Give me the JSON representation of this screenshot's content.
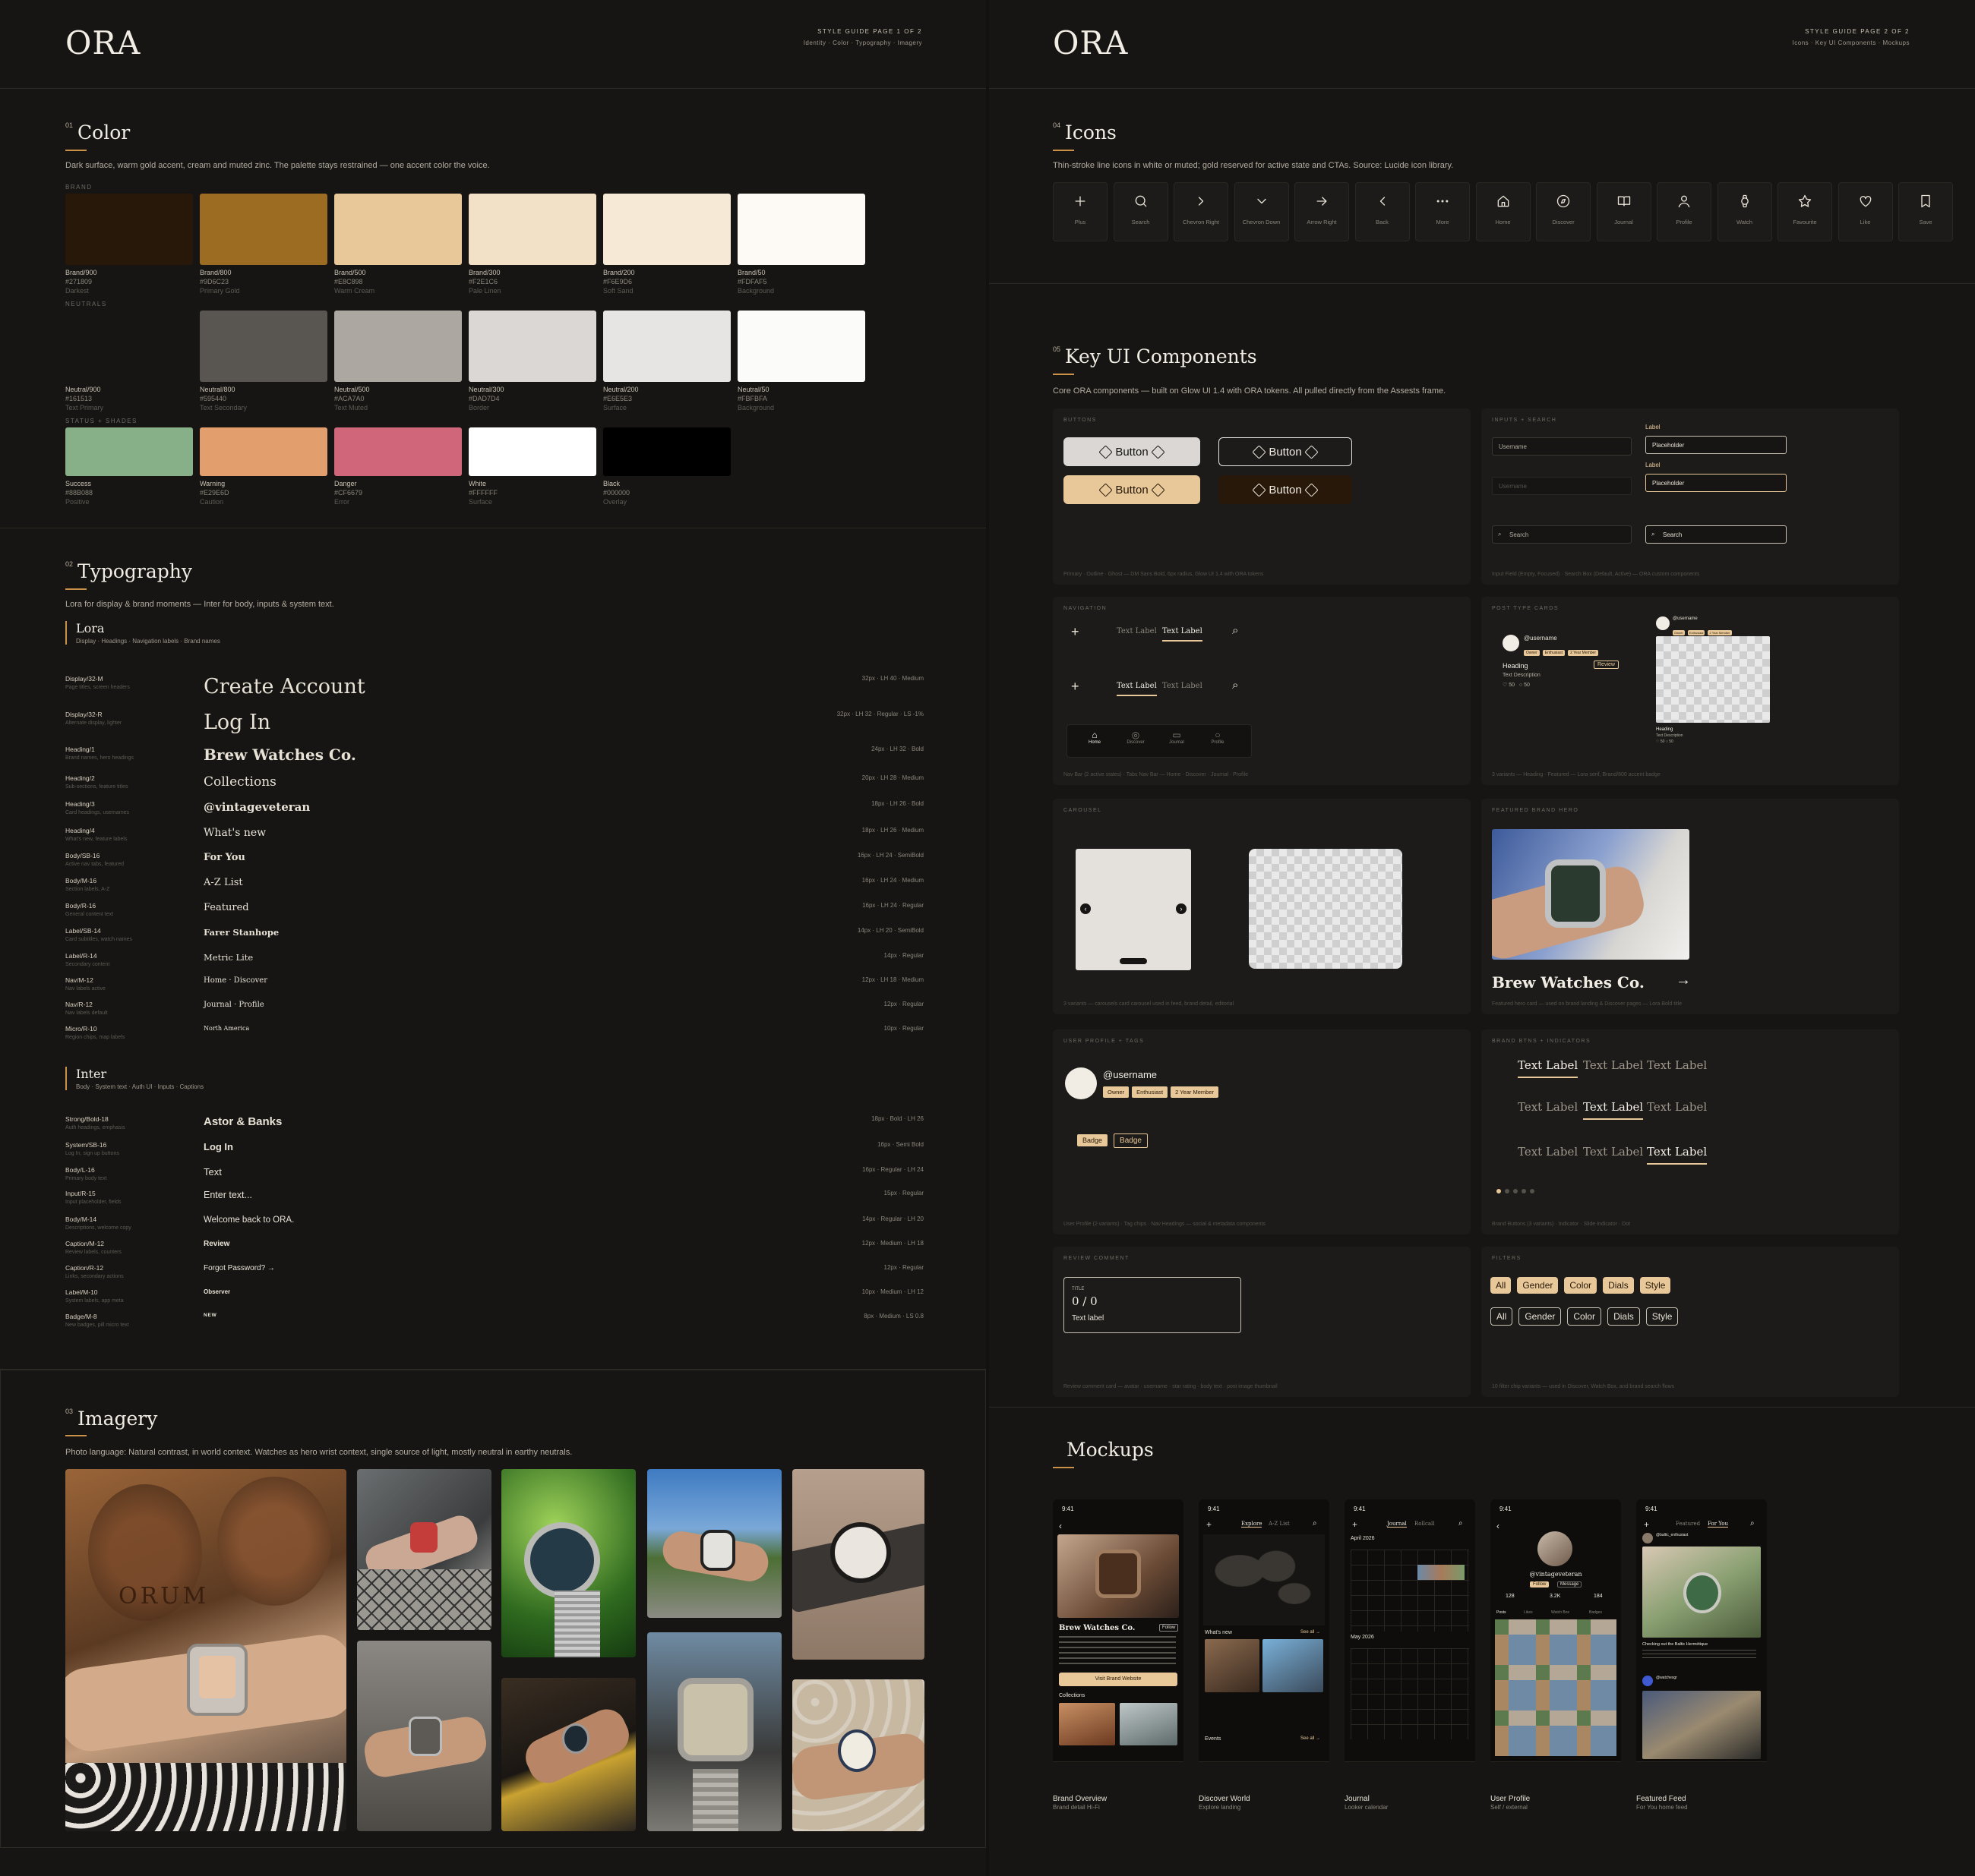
{
  "page1": {
    "logo": "ORA",
    "header_title": "STYLE GUIDE PAGE 1 OF 2",
    "header_sub": "Identity · Color · Typography · Imagery"
  },
  "page2": {
    "logo": "ORA",
    "header_title": "STYLE GUIDE PAGE 2 OF 2",
    "header_sub": "Icons · Key UI Components · Mockups"
  },
  "color": {
    "num": "01",
    "title": "Color",
    "desc": "Dark surface, warm gold accent, cream and muted zinc. The palette stays restrained — one accent color the voice.",
    "brand_label": "BRAND",
    "neutrals_label": "NEUTRALS",
    "status_label": "STATUS + SHADES",
    "brand": [
      {
        "name": "Brand/900",
        "hex": "#271809",
        "desc": "Darkest",
        "color": "#271809"
      },
      {
        "name": "Brand/800",
        "hex": "#9D6C23",
        "desc": "Primary Gold",
        "color": "#9D6C23"
      },
      {
        "name": "Brand/500",
        "hex": "#E8C898",
        "desc": "Warm Cream",
        "color": "#E8C898"
      },
      {
        "name": "Brand/300",
        "hex": "#F2E1C6",
        "desc": "Pale Linen",
        "color": "#F2E1C6"
      },
      {
        "name": "Brand/200",
        "hex": "#F6E9D6",
        "desc": "Soft Sand",
        "color": "#F6E9D6"
      },
      {
        "name": "Brand/50",
        "hex": "#FDFAF5",
        "desc": "Background",
        "color": "#FDFAF5"
      }
    ],
    "neutrals": [
      {
        "name": "Neutral/900",
        "hex": "#161513",
        "desc": "Text Primary",
        "color": "#161513"
      },
      {
        "name": "Neutral/800",
        "hex": "#595440",
        "desc": "Text Secondary",
        "color": "#595550"
      },
      {
        "name": "Neutral/500",
        "hex": "#ACA7A0",
        "desc": "Text Muted",
        "color": "#ACA7A0"
      },
      {
        "name": "Neutral/300",
        "hex": "#DAD7D4",
        "desc": "Border",
        "color": "#DAD7D4"
      },
      {
        "name": "Neutral/200",
        "hex": "#E6E5E3",
        "desc": "Surface",
        "color": "#E6E5E3"
      },
      {
        "name": "Neutral/50",
        "hex": "#FBFBFA",
        "desc": "Background",
        "color": "#FBFBFA"
      }
    ],
    "status": [
      {
        "name": "Success",
        "hex": "#88B088",
        "desc": "Positive",
        "color": "#88B088"
      },
      {
        "name": "Warning",
        "hex": "#E29E6D",
        "desc": "Caution",
        "color": "#E29E6D"
      },
      {
        "name": "Danger",
        "hex": "#CF6679",
        "desc": "Error",
        "color": "#CF6679"
      },
      {
        "name": "White",
        "hex": "#FFFFFF",
        "desc": "Surface",
        "color": "#FFFFFF"
      },
      {
        "name": "Black",
        "hex": "#000000",
        "desc": "Overlay",
        "color": "#000000"
      }
    ]
  },
  "typography": {
    "num": "02",
    "title": "Typography",
    "desc": "Lora for display & brand moments — Inter for body, inputs & system text.",
    "lora": {
      "name": "Lora",
      "usage": "Display · Headings · Navigation labels · Brand names"
    },
    "inter": {
      "name": "Inter",
      "usage": "Body · System text · Auth UI · Inputs · Captions"
    },
    "lora_rows": [
      {
        "name": "Display/32-M",
        "sub": "Page titles, screen headers",
        "sample": "Create Account",
        "spec": "32px · LH 40 · Medium"
      },
      {
        "name": "Display/32-R",
        "sub": "Alternate display, lighter",
        "sample": "Log In",
        "spec": "32px · LH 32 · Regular · LS -1%"
      },
      {
        "name": "Heading/1",
        "sub": "Brand names, hero headings",
        "sample": "Brew Watches Co.",
        "spec": "24px · LH 32 · Bold"
      },
      {
        "name": "Heading/2",
        "sub": "Sub-sections, feature titles",
        "sample": "Collections",
        "spec": "20px · LH 28 · Medium"
      },
      {
        "name": "Heading/3",
        "sub": "Card headings, usernames",
        "sample": "@vintageveteran",
        "spec": "18px · LH 26 · Bold"
      },
      {
        "name": "Heading/4",
        "sub": "What's new, feature labels",
        "sample": "What's new",
        "spec": "18px · LH 26 · Medium"
      },
      {
        "name": "Body/SB-16",
        "sub": "Active nav tabs, featured",
        "sample": "For You",
        "spec": "16px · LH 24 · SemiBold"
      },
      {
        "name": "Body/M-16",
        "sub": "Section labels, A-Z",
        "sample": "A-Z List",
        "spec": "16px · LH 24 · Medium"
      },
      {
        "name": "Body/R-16",
        "sub": "General content text",
        "sample": "Featured",
        "spec": "16px · LH 24 · Regular"
      },
      {
        "name": "Label/SB-14",
        "sub": "Card subtitles, watch names",
        "sample": "Farer Stanhope",
        "spec": "14px · LH 20 · SemiBold"
      },
      {
        "name": "Label/R-14",
        "sub": "Secondary content",
        "sample": "Metric Lite",
        "spec": "14px · Regular"
      },
      {
        "name": "Nav/M-12",
        "sub": "Nav labels active",
        "sample": "Home · Discover",
        "spec": "12px · LH 18 · Medium"
      },
      {
        "name": "Nav/R-12",
        "sub": "Nav labels default",
        "sample": "Journal · Profile",
        "spec": "12px · Regular"
      },
      {
        "name": "Micro/R-10",
        "sub": "Region chips, map labels",
        "sample": "North America",
        "spec": "10px · Regular"
      }
    ],
    "inter_rows": [
      {
        "name": "Strong/Bold-18",
        "sub": "Auth headings, emphasis",
        "sample": "Astor & Banks",
        "spec": "18px · Bold · LH 26"
      },
      {
        "name": "System/SB-16",
        "sub": "Log In, sign up buttons",
        "sample": "Log In",
        "spec": "16px · Semi Bold"
      },
      {
        "name": "Body/L-16",
        "sub": "Primary body text",
        "sample": "Text",
        "spec": "16px · Regular · LH 24"
      },
      {
        "name": "Input/R-15",
        "sub": "Input placeholder, fields",
        "sample": "Enter text...",
        "spec": "15px · Regular"
      },
      {
        "name": "Body/M-14",
        "sub": "Descriptions, welcome copy",
        "sample": "Welcome back to ORA.",
        "spec": "14px · Regular · LH 20"
      },
      {
        "name": "Caption/M-12",
        "sub": "Review labels, counters",
        "sample": "Review",
        "spec": "12px · Medium · LH 18"
      },
      {
        "name": "Caption/R-12",
        "sub": "Links, secondary actions",
        "sample": "Forgot Password? →",
        "spec": "12px · Regular"
      },
      {
        "name": "Label/M-10",
        "sub": "System labels, app meta",
        "sample": "Observer",
        "spec": "10px · Medium · LH 12"
      },
      {
        "name": "Badge/M-8",
        "sub": "New badges, pill micro text",
        "sample": "NEW",
        "spec": "8px · Medium · LS 0.8"
      }
    ]
  },
  "imagery": {
    "num": "03",
    "title": "Imagery",
    "desc": "Photo language: Natural contrast, in world context. Watches as hero wrist context, single source of light, mostly neutral in earthy neutrals.",
    "photo_text": "ORUM"
  },
  "icons": {
    "num": "04",
    "title": "Icons",
    "desc": "Thin-stroke line icons in white or muted; gold reserved for active state and CTAs. Source: Lucide icon library.",
    "items": [
      "Plus",
      "Search",
      "Chevron Right",
      "Chevron Down",
      "Arrow Right",
      "Back",
      "More",
      "Home",
      "Discover",
      "Journal",
      "Profile",
      "Watch",
      "Favourite",
      "Like",
      "Save"
    ]
  },
  "components": {
    "num": "05",
    "title": "Key UI Components",
    "desc": "Core ORA components — built on Glow UI 1.4 with ORA tokens. All pulled directly from the Assests frame.",
    "buttons": {
      "label": "BUTTONS",
      "text": "Button",
      "footer": "Primary · Outline · Ghost — DM Sans Bold, 6px radius, Glow UI 1.4 with ORA tokens"
    },
    "inputs": {
      "label": "INPUTS + SEARCH",
      "username": "Username",
      "field_label": "Label",
      "placeholder": "Placeholder",
      "search": "Search",
      "footer": "Input Field (Empty, Focused) · Search Box (Default, Active) — ORA custom components"
    },
    "navigation": {
      "label": "NAVIGATION",
      "tab": "Text Label",
      "nav": [
        "Home",
        "Discover",
        "Journal",
        "Profile"
      ],
      "footer": "Nav Bar (2 active states) · Tabs Nav Bar — Home · Discover · Journal · Profile"
    },
    "posts": {
      "label": "POST TYPE CARDS",
      "username": "@username",
      "chips": [
        "Owner",
        "Enthusiast",
        "2 Year Member"
      ],
      "heading": "Heading",
      "review": "Review",
      "text_desc": "Text Description",
      "count1": "50",
      "count2": "50",
      "small_count": "50",
      "footer": "3 variants — Heading · Featured — Lora serif, Brand/800 accent badge"
    },
    "carousel": {
      "label": "CAROUSEL",
      "footer": "3 variants — carousels card carousel used in feed, brand detail, editorial"
    },
    "hero": {
      "label": "FEATURED BRAND HERO",
      "title": "Brew Watches Co.",
      "footer": "Featured hero card — used on brand landing & Discover pages — Lora Bold title"
    },
    "profile": {
      "label": "USER PROFILE + TAGS",
      "username": "@username",
      "chips": [
        "Owner",
        "Enthusiast",
        "2 Year Member"
      ],
      "badge": "Badge",
      "footer": "User Profile (2 variants) · Tag chips · Nav Headings — social & metadata components"
    },
    "brandbtns": {
      "label": "BRAND BTNS + INDICATORS",
      "text": "Text Label",
      "footer": "Brand Buttons (3 variants) · Indicator · Slide Indicator · Dot"
    },
    "review": {
      "label": "REVIEW COMMENT",
      "title_small": "TITLE",
      "score": "0 / 0",
      "text": "Text label",
      "footer": "Review comment card — avatar · username · star rating · body text · post image thumbnail"
    },
    "filters": {
      "label": "FILTERS",
      "items": [
        "All",
        "Gender",
        "Color",
        "Dials",
        "Style"
      ],
      "footer": "10 filter chip variants — used in Discover, Watch Box, and brand search flows"
    }
  },
  "mockups": {
    "title": "Mockups",
    "time": "9:41",
    "screens": [
      {
        "title": "Brand Overview",
        "sub": "Brand detail Hi-Fi",
        "heading": "Brew Watches Co.",
        "follow": "Follow",
        "cta": "Visit Brand Website",
        "section": "Collections"
      },
      {
        "title": "Discover World",
        "sub": "Explore landing",
        "tabs": [
          "Explore",
          "A-Z List"
        ],
        "section": "What's new",
        "see_all": "See all →",
        "events": "Events"
      },
      {
        "title": "Journal",
        "sub": "Looker calendar",
        "tabs": [
          "Journal",
          "Rollcall"
        ],
        "month1": "April 2026",
        "month2": "May 2026"
      },
      {
        "title": "User Profile",
        "sub": "Self / external",
        "username": "@vintageveteran",
        "stats": [
          "128",
          "3.2K",
          "184"
        ],
        "tabs": [
          "Posts",
          "Likes",
          "Watch Box",
          "Badges"
        ],
        "follow": "Follow",
        "message": "Message"
      },
      {
        "title": "Featured Feed",
        "sub": "For You home feed",
        "tabs": [
          "Featured",
          "For You"
        ],
        "user1": "@baltic_enthusiast",
        "user2": "@watchesgr",
        "caption": "Checking out the Baltic Hermétique"
      }
    ]
  },
  "colors": {
    "bg": "#161513",
    "accent": "#C99248",
    "cream": "#E8C898"
  }
}
